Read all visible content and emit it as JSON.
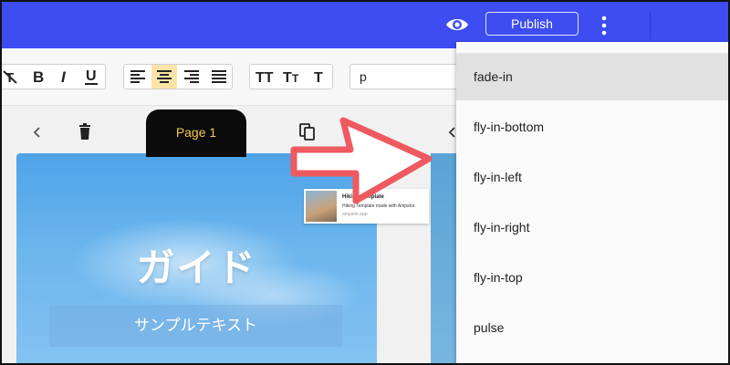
{
  "topbar": {
    "publish_label": "Publish",
    "bg_color": "#3d4df1"
  },
  "toolbar": {
    "buttons": [
      {
        "icon": "clear-format-icon"
      },
      {
        "icon": "bold-icon",
        "label": "B"
      },
      {
        "icon": "italic-icon",
        "label": "I"
      },
      {
        "icon": "underline-icon",
        "label": "U"
      },
      {
        "icon": "align-left-icon"
      },
      {
        "icon": "align-center-icon",
        "active": true
      },
      {
        "icon": "align-right-icon"
      },
      {
        "icon": "align-justify-icon"
      },
      {
        "icon": "text-size-large-icon",
        "label": "TT"
      },
      {
        "icon": "text-size-medium-icon",
        "label": "Tт"
      },
      {
        "icon": "text-size-small-icon",
        "label": "T"
      }
    ],
    "font_select_value": "p",
    "active_color": "#fbe4a8"
  },
  "editor": {
    "page_tab_label": "Page 1",
    "page_title": "ガイド",
    "page_subtitle": "サンプルテキスト"
  },
  "preview": {
    "title": "Hiking Template",
    "description": "Hiking Template made with Ampstor.",
    "url": "ampstor.app"
  },
  "animation_menu": {
    "items": [
      "fade-in",
      "fly-in-bottom",
      "fly-in-left",
      "fly-in-right",
      "fly-in-top",
      "pulse"
    ],
    "selected": "fade-in"
  },
  "annotation": {
    "arrow_color": "#ee5a60"
  }
}
